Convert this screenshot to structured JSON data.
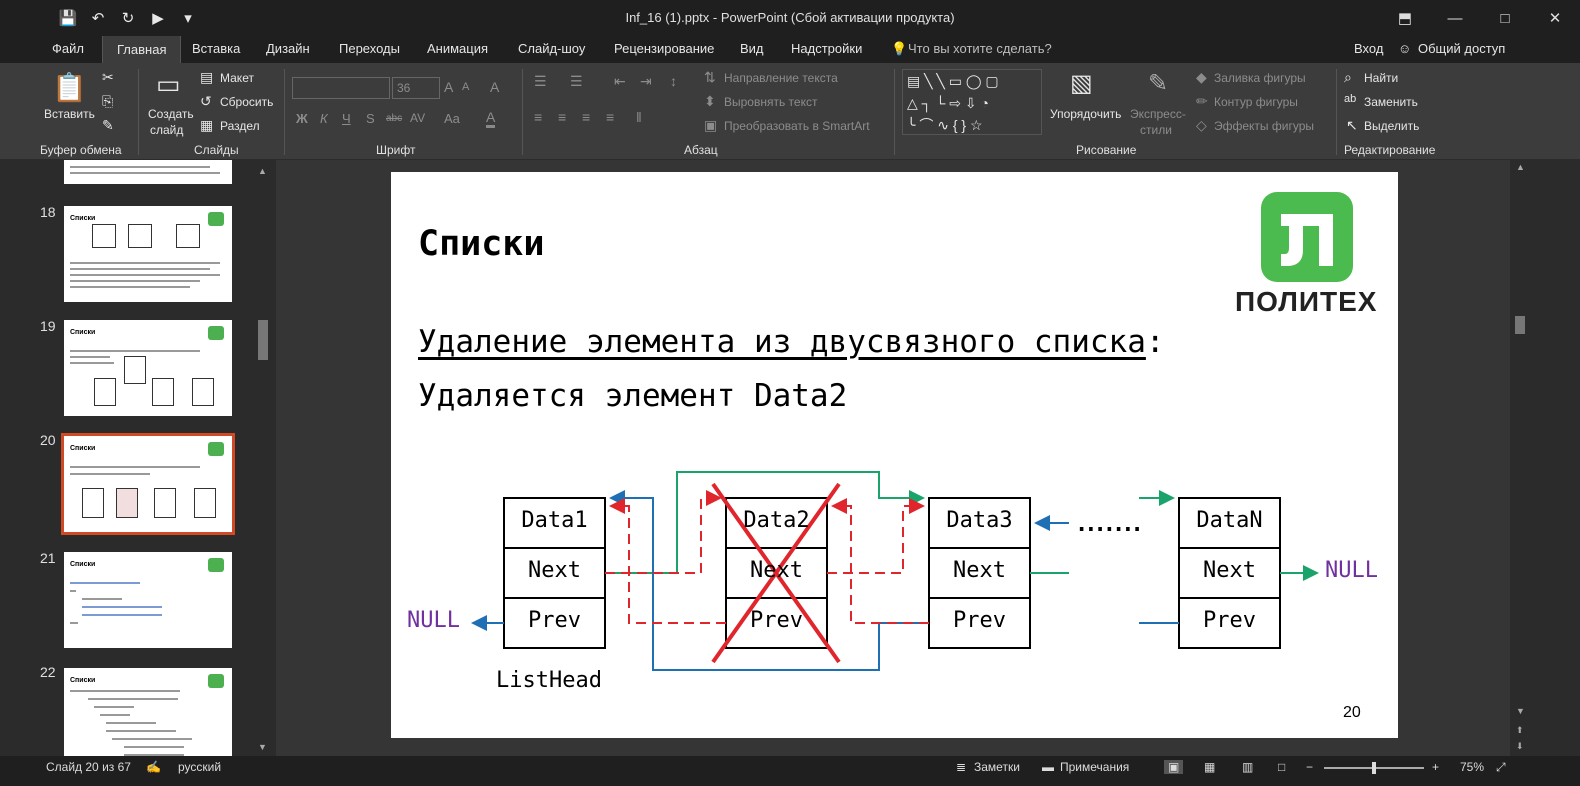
{
  "window": {
    "title": "Inf_16 (1).pptx - PowerPoint (Сбой активации продукта)"
  },
  "tabs": [
    {
      "label": "Файл"
    },
    {
      "label": "Главная"
    },
    {
      "label": "Вставка"
    },
    {
      "label": "Дизайн"
    },
    {
      "label": "Переходы"
    },
    {
      "label": "Анимация"
    },
    {
      "label": "Слайд-шоу"
    },
    {
      "label": "Рецензирование"
    },
    {
      "label": "Вид"
    },
    {
      "label": "Надстройки"
    }
  ],
  "tellme": "Что вы хотите сделать?",
  "signin": "Вход",
  "share": "Общий доступ",
  "ribbon": {
    "clipboard": {
      "paste": "Вставить",
      "group": "Буфер обмена"
    },
    "slides": {
      "new_slide_1": "Создать",
      "new_slide_2": "слайд",
      "layout": "Макет",
      "reset": "Сбросить",
      "section": "Раздел",
      "group": "Слайды"
    },
    "font": {
      "size": "36",
      "group": "Шрифт",
      "bold": "Ж",
      "italic": "К",
      "underline": "Ч",
      "shadow": "S",
      "strike": "abc",
      "spacing": "AV",
      "case": "Aa",
      "grow": "A",
      "shrink": "A",
      "clear": "A"
    },
    "paragraph": {
      "direction": "Направление текста",
      "align": "Выровнять текст",
      "smartart": "Преобразовать в SmartArt",
      "group": "Абзац"
    },
    "drawing": {
      "arrange": "Упорядочить",
      "quick_1": "Экспресс-",
      "quick_2": "стили",
      "fill": "Заливка фигуры",
      "outline": "Контур фигуры",
      "effects": "Эффекты фигуры",
      "group": "Рисование"
    },
    "editing": {
      "find": "Найти",
      "replace": "Заменить",
      "select": "Выделить",
      "group": "Редактирование"
    }
  },
  "thumbnails": [
    {
      "num": "18",
      "title": "Списки"
    },
    {
      "num": "19",
      "title": "Списки"
    },
    {
      "num": "20",
      "title": "Списки"
    },
    {
      "num": "21",
      "title": "Списки"
    },
    {
      "num": "22",
      "title": "Списки"
    }
  ],
  "slide": {
    "title": "Списки",
    "subtitle_underlined": "Удаление элемента из двусвязного списка",
    "subtitle_colon": ":",
    "line2": "Удаляется элемент Data2",
    "logo_text": "ПОЛИТЕХ",
    "number": "20",
    "nodes": [
      {
        "data": "Data1",
        "next": "Next",
        "prev": "Prev"
      },
      {
        "data": "Data2",
        "next": "Next",
        "prev": "Prev"
      },
      {
        "data": "Data3",
        "next": "Next",
        "prev": "Prev"
      },
      {
        "data": "DataN",
        "next": "Next",
        "prev": "Prev"
      }
    ],
    "null_left": "NULL",
    "null_right": "NULL",
    "dots": ".......",
    "listhead": "ListHead",
    "colors": {
      "green": "#1aa36b",
      "blue": "#1f6fb5",
      "red": "#e0262c",
      "null": "#7030a0"
    }
  },
  "status": {
    "slide_info": "Слайд 20 из 67",
    "language": "русский",
    "notes": "Заметки",
    "comments": "Примечания",
    "zoom": "75%"
  }
}
